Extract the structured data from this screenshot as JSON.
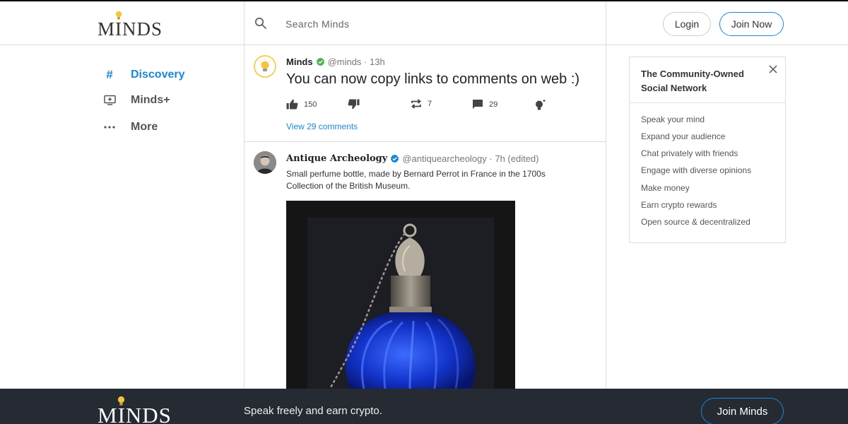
{
  "header": {
    "logo_text": "MINDS",
    "search_placeholder": "Search Minds",
    "login_label": "Login",
    "join_label": "Join Now"
  },
  "sidebar": {
    "items": [
      {
        "label": "Discovery",
        "icon": "hash-icon",
        "active": true
      },
      {
        "label": "Minds+",
        "icon": "monitor-plus-icon"
      },
      {
        "label": "More",
        "icon": "more-dots-icon"
      }
    ]
  },
  "posts": [
    {
      "author": "Minds",
      "handle": "@minds",
      "time": "13h",
      "title": "You can now copy links to comments on web :)",
      "actions": {
        "upvotes": "150",
        "remind": "7",
        "comments": "29"
      },
      "view_comments": "View 29 comments"
    },
    {
      "author": "Antique Archeology",
      "handle": "@antiquearcheology",
      "time": "7h (edited)",
      "body_line1": "Small perfume bottle, made by Bernard Perrot in France in the 1700s",
      "body_line2": "Collection of the British Museum."
    }
  ],
  "card": {
    "title": "The Community-Owned Social Network",
    "features": [
      "Speak your mind",
      "Expand your audience",
      "Chat privately with friends",
      "Engage with diverse opinions",
      "Make money",
      "Earn crypto rewards",
      "Open source & decentralized"
    ]
  },
  "footer": {
    "logo_text": "MINDS",
    "tagline": "Speak freely and earn crypto.",
    "join_label": "Join Minds"
  },
  "colors": {
    "accent": "#1b85d6",
    "verified": "#4caf50",
    "footer_bg": "#262b33",
    "bulb": "#f2c53d"
  }
}
